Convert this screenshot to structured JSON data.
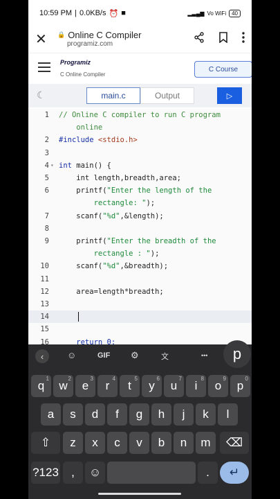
{
  "status": {
    "time": "10:59 PM",
    "network": "0.0KB/s",
    "battery": "40",
    "wifi": "Vo WiFi"
  },
  "browser": {
    "title": "Online C Compiler",
    "url": "programiz.com",
    "close_icon": "close-icon",
    "share_icon": "share-icon",
    "bookmark_icon": "bookmark-icon",
    "menu_icon": "more-vert-icon"
  },
  "site": {
    "logo": "Programiz",
    "subtitle": "C Online Compiler",
    "course_button": "C Course"
  },
  "tabs": {
    "main": "main.c",
    "output": "Output",
    "run_icon": "play-icon"
  },
  "editor": {
    "lines": [
      {
        "n": "1",
        "segs": [
          {
            "t": "// Online C compiler to run C program",
            "c": "cm"
          }
        ]
      },
      {
        "n": "",
        "segs": [
          {
            "t": "    online",
            "c": "cm"
          }
        ]
      },
      {
        "n": "2",
        "segs": [
          {
            "t": "#include ",
            "c": "kw"
          },
          {
            "t": "<stdio.h>",
            "c": "inc"
          }
        ]
      },
      {
        "n": "3",
        "segs": []
      },
      {
        "n": "4",
        "fold": true,
        "segs": [
          {
            "t": "int",
            "c": "kw"
          },
          {
            "t": " main() {",
            "c": ""
          }
        ]
      },
      {
        "n": "5",
        "segs": [
          {
            "t": "    int length,breadth,area;",
            "c": ""
          }
        ]
      },
      {
        "n": "6",
        "segs": [
          {
            "t": "    printf(",
            "c": ""
          },
          {
            "t": "\"Enter the length of the",
            "c": "str"
          }
        ]
      },
      {
        "n": "",
        "segs": [
          {
            "t": "        rectangle: \"",
            "c": "str"
          },
          {
            "t": ");",
            "c": ""
          }
        ]
      },
      {
        "n": "7",
        "segs": [
          {
            "t": "    scanf(",
            "c": ""
          },
          {
            "t": "\"%d\"",
            "c": "str"
          },
          {
            "t": ",&length);",
            "c": ""
          }
        ]
      },
      {
        "n": "8",
        "segs": []
      },
      {
        "n": "9",
        "segs": [
          {
            "t": "    printf(",
            "c": ""
          },
          {
            "t": "\"Enter the breadth of the",
            "c": "str"
          }
        ]
      },
      {
        "n": "",
        "segs": [
          {
            "t": "        rectangle : \"",
            "c": "str"
          },
          {
            "t": ");",
            "c": ""
          }
        ]
      },
      {
        "n": "10",
        "segs": [
          {
            "t": "    scanf(",
            "c": ""
          },
          {
            "t": "\"%d\"",
            "c": "str"
          },
          {
            "t": ",&breadth);",
            "c": ""
          }
        ]
      },
      {
        "n": "11",
        "segs": []
      },
      {
        "n": "12",
        "segs": [
          {
            "t": "    area=length*breadth;",
            "c": ""
          }
        ]
      },
      {
        "n": "13",
        "segs": []
      },
      {
        "n": "14",
        "active": true,
        "segs": []
      },
      {
        "n": "15",
        "segs": []
      },
      {
        "n": "16",
        "segs": [
          {
            "t": "    return 0;",
            "c": "kw"
          }
        ]
      }
    ]
  },
  "keyboard": {
    "toolbar": {
      "back_icon": "chevron-left-icon",
      "sticker_icon": "sticker-icon",
      "gif": "GIF",
      "settings_icon": "gear-icon",
      "translate_icon": "translate-icon",
      "more": "•••",
      "preview": "p"
    },
    "row1": [
      {
        "k": "q",
        "h": "1"
      },
      {
        "k": "w",
        "h": "2"
      },
      {
        "k": "e",
        "h": "3"
      },
      {
        "k": "r",
        "h": "4"
      },
      {
        "k": "t",
        "h": "5"
      },
      {
        "k": "y",
        "h": "6"
      },
      {
        "k": "u",
        "h": "7"
      },
      {
        "k": "i",
        "h": "8"
      },
      {
        "k": "o",
        "h": "9"
      },
      {
        "k": "p",
        "h": "0"
      }
    ],
    "row2": [
      "a",
      "s",
      "d",
      "f",
      "g",
      "h",
      "j",
      "k",
      "l"
    ],
    "row3": [
      "z",
      "x",
      "c",
      "v",
      "b",
      "n",
      "m"
    ],
    "shift": "⇧",
    "backspace": "⌫",
    "symbols": "?123",
    "comma": ",",
    "emoji": "☺",
    "period": ".",
    "enter": "↵"
  }
}
